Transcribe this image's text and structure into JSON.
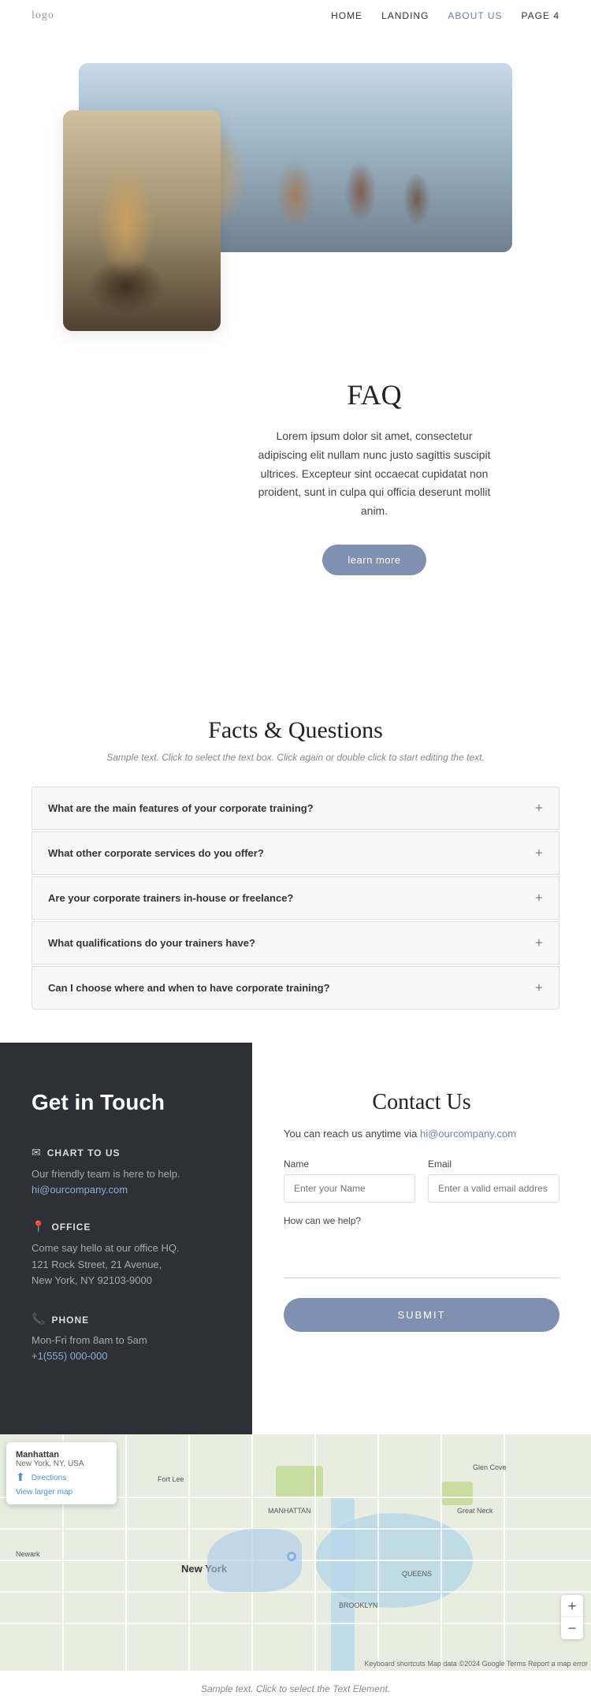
{
  "nav": {
    "logo": "logo",
    "links": [
      {
        "id": "home",
        "label": "HOME"
      },
      {
        "id": "landing",
        "label": "LANDING"
      },
      {
        "id": "about",
        "label": "ABOUT US",
        "active": true
      },
      {
        "id": "page4",
        "label": "PAGE 4"
      }
    ]
  },
  "hero": {
    "faq_title": "FAQ",
    "faq_desc": "Lorem ipsum dolor sit amet, consectetur adipiscing elit nullam nunc justo sagittis suscipit ultrices. Excepteur sint occaecat cupidatat non proident, sunt in culpa qui officia deserunt mollit anim.",
    "learn_more": "learn more"
  },
  "facts": {
    "title": "Facts & Questions",
    "subtitle": "Sample text. Click to select the text box. Click again or double click to start editing the text.",
    "questions": [
      {
        "id": "q1",
        "text": "What are the main features of your corporate training?"
      },
      {
        "id": "q2",
        "text": "What other corporate services do you offer?"
      },
      {
        "id": "q3",
        "text": "Are your corporate trainers in-house or freelance?"
      },
      {
        "id": "q4",
        "text": "What qualifications do your trainers have?"
      },
      {
        "id": "q5",
        "text": "Can I choose where and when to have corporate training?"
      }
    ]
  },
  "contact_left": {
    "title": "Get in Touch",
    "chart_label": "CHART TO US",
    "chart_desc": "Our friendly team is here to help.",
    "chart_email": "hi@ourcompany.com",
    "office_label": "OFFICE",
    "office_desc": "Come say hello at our office HQ.",
    "office_address1": "121 Rock Street, 21 Avenue,",
    "office_address2": "New York, NY 92103-9000",
    "phone_label": "PHONE",
    "phone_hours": "Mon-Fri from 8am to 5am",
    "phone_number": "+1(555) 000-000"
  },
  "contact_right": {
    "title": "Contact Us",
    "reach_text": "You can reach us anytime via",
    "email_link": "hi@ourcompany.com",
    "name_label": "Name",
    "name_placeholder": "Enter your Name",
    "email_label": "Email",
    "email_placeholder": "Enter a valid email addres",
    "how_label": "How can we help?",
    "submit_label": "SUBMIT"
  },
  "map": {
    "place": "Manhattan",
    "address": "New York, NY, USA",
    "directions": "Directions",
    "view_larger": "View larger map",
    "attribution": "Keyboard shortcuts  Map data ©2024 Google  Terms  Report a map error",
    "zoom_in": "+",
    "zoom_out": "−"
  },
  "footer": {
    "text": "Sample text. Click to select the Text Element."
  }
}
